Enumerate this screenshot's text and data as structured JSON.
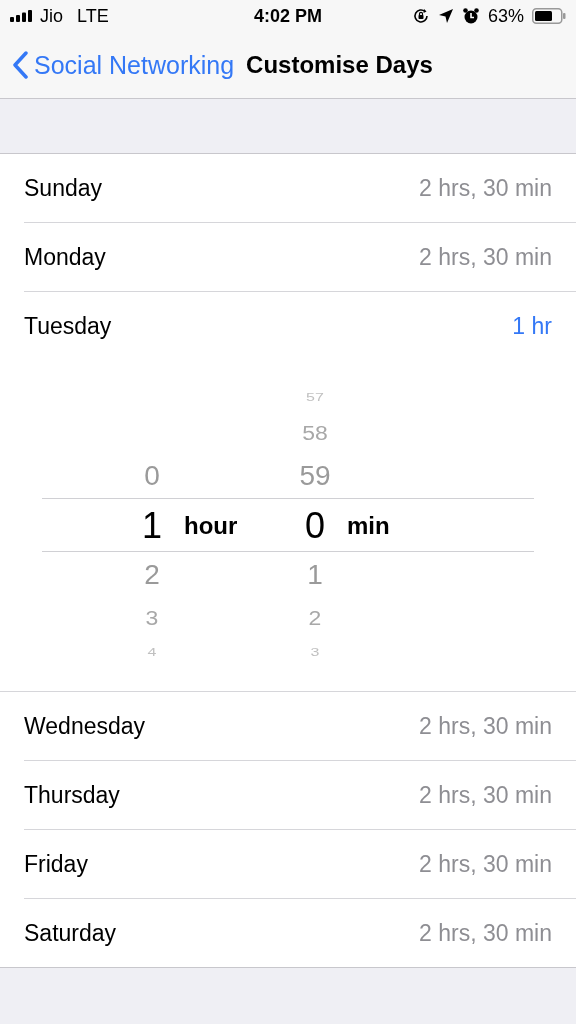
{
  "status_bar": {
    "carrier": "Jio",
    "network": "LTE",
    "time": "4:02 PM",
    "battery": "63%"
  },
  "nav": {
    "back": "Social Networking",
    "title": "Customise Days"
  },
  "days_before": [
    {
      "day": "Sunday",
      "value": "2 hrs, 30 min",
      "selected": false
    },
    {
      "day": "Monday",
      "value": "2 hrs, 30 min",
      "selected": false
    },
    {
      "day": "Tuesday",
      "value": "1 hr",
      "selected": true
    }
  ],
  "picker": {
    "columns": [
      {
        "above": [
          "0"
        ],
        "value": "1",
        "unit": "hour",
        "below": [
          "2",
          "3",
          "4"
        ]
      },
      {
        "above": [
          "57",
          "58",
          "59"
        ],
        "value": "0",
        "unit": "min",
        "below": [
          "1",
          "2",
          "3"
        ]
      }
    ]
  },
  "days_after": [
    {
      "day": "Wednesday",
      "value": "2 hrs, 30 min",
      "selected": false
    },
    {
      "day": "Thursday",
      "value": "2 hrs, 30 min",
      "selected": false
    },
    {
      "day": "Friday",
      "value": "2 hrs, 30 min",
      "selected": false
    },
    {
      "day": "Saturday",
      "value": "2 hrs, 30 min",
      "selected": false
    }
  ]
}
